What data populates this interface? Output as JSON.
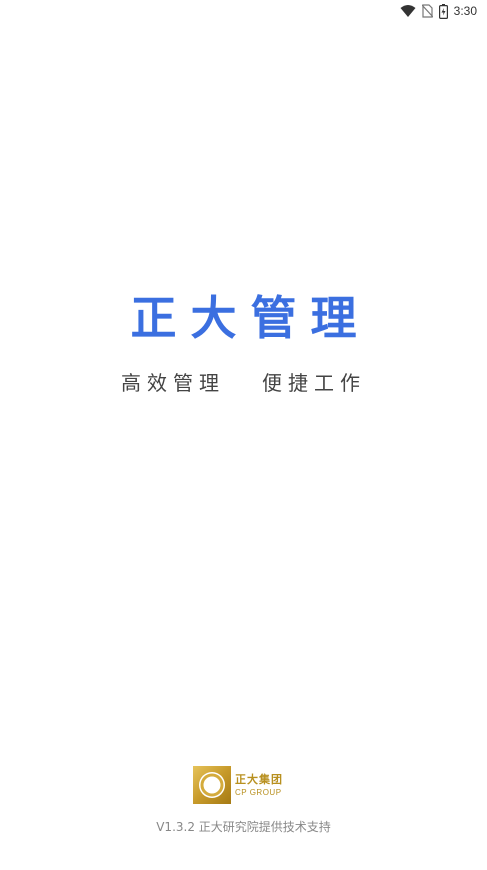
{
  "status_bar": {
    "time": "3:30",
    "icons": [
      "wifi-icon",
      "no-sim-icon",
      "battery-icon"
    ]
  },
  "splash": {
    "title": "正大管理",
    "subtitle": "高效管理   便捷工作"
  },
  "footer": {
    "logo_cn": "正大集团",
    "logo_en": "CP GROUP",
    "version_text": "V1.3.2 正大研究院提供技术支持"
  },
  "colors": {
    "title": "#3b6fe0",
    "subtitle": "#444444",
    "logo_gold": "#b8901f",
    "footer_text": "#888888",
    "background": "#ffffff"
  }
}
